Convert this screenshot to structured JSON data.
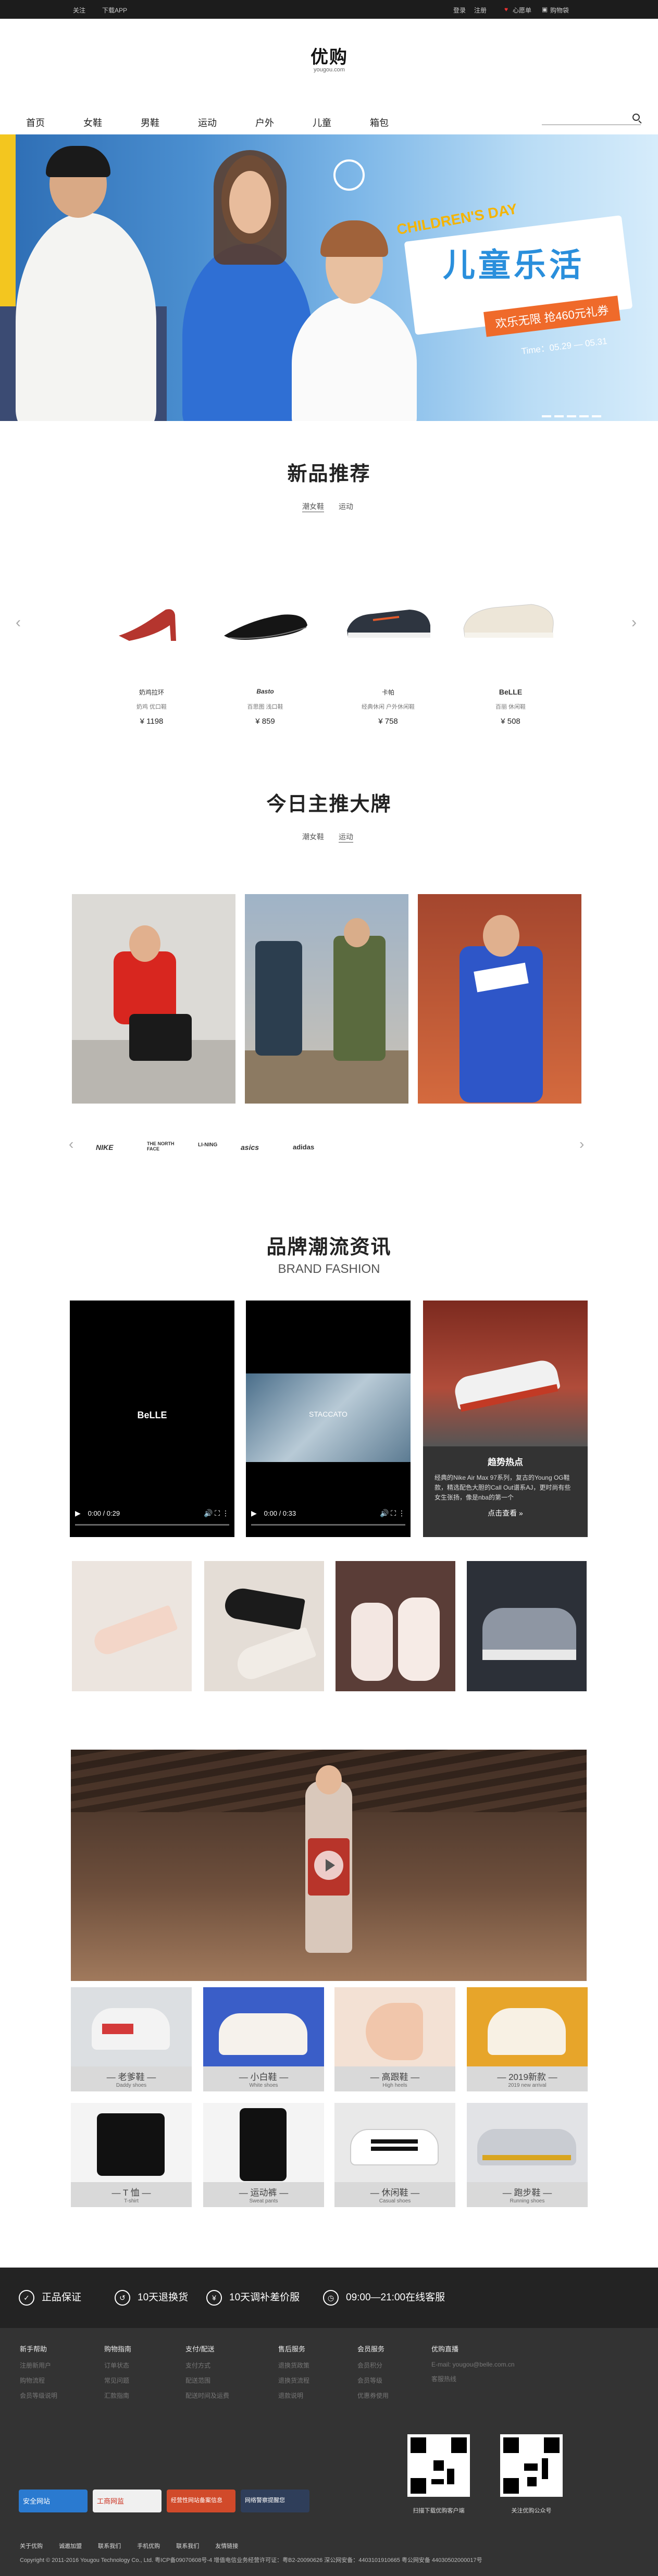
{
  "topbar": {
    "left": [
      "关注",
      "下载APP"
    ],
    "right": [
      "登录",
      "注册",
      "心愿单",
      "购物袋"
    ]
  },
  "logo": {
    "cn": "优购",
    "en": "yougou.com"
  },
  "nav": {
    "items": [
      "首页",
      "女鞋",
      "男鞋",
      "运动",
      "户外",
      "儿童",
      "箱包"
    ]
  },
  "banner": {
    "kids_day": "CHILDREN'S DAY",
    "title": "儿童乐活",
    "promo": "欢乐无限  抢460元礼券",
    "time": "Time：05.29 — 05.31"
  },
  "new_products": {
    "title": "新品推荐",
    "tabs": [
      "潮女鞋",
      "运动"
    ],
    "items": [
      {
        "brand": "奶鸡拉环",
        "name": "奶鸡 优口鞋",
        "price": "¥ 1198"
      },
      {
        "brand": "Basto",
        "name": "百思图 浅口鞋",
        "price": "¥ 859"
      },
      {
        "brand": "卡帕",
        "name": "经典休闲 户外休闲鞋",
        "price": "¥ 758"
      },
      {
        "brand": "BeLLE",
        "name": "百丽 休闲鞋",
        "price": "¥ 508"
      }
    ]
  },
  "brands": {
    "title": "今日主推大牌",
    "tabs": [
      "潮女鞋",
      "运动"
    ],
    "logos": [
      "NIKE",
      "THE NORTH FACE",
      "LI-NING",
      "asics",
      "adidas"
    ]
  },
  "fashion": {
    "title": "品牌潮流资讯",
    "subtitle": "BRAND FASHION",
    "video1": {
      "logo": "BeLLE",
      "time": "0:00 / 0:29"
    },
    "video2": {
      "caption": "STACCATO",
      "time": "0:00 / 0:33"
    },
    "trend": {
      "heading": "趋势热点",
      "text": "经典的Nike Air Max 97系列，复古的Young OG鞋款，精选配色大胆的Call Out谱系AJ，更时尚有些女生张扬，像是nba的第一个",
      "link": "点击查看 »"
    }
  },
  "categories": [
    {
      "cn": "— 老爹鞋 —",
      "en": "Daddy shoes"
    },
    {
      "cn": "— 小白鞋 —",
      "en": "White shoes"
    },
    {
      "cn": "— 高跟鞋 —",
      "en": "High heels"
    },
    {
      "cn": "— 2019新款 —",
      "en": "2019 new arrival"
    },
    {
      "cn": "— T 恤 —",
      "en": "T-shirt"
    },
    {
      "cn": "— 运动裤 —",
      "en": "Sweat pants"
    },
    {
      "cn": "— 休闲鞋 —",
      "en": "Casual shoes"
    },
    {
      "cn": "— 跑步鞋 —",
      "en": "Running shoes"
    }
  ],
  "service": [
    "正品保证",
    "10天退换货",
    "10天调补差价服",
    "09:00—21:00在线客服"
  ],
  "footer": {
    "columns": [
      {
        "h": "新手帮助",
        "items": [
          "注册新用户",
          "购物流程",
          "会员等级说明"
        ]
      },
      {
        "h": "购物指南",
        "items": [
          "订单状态",
          "常见问题",
          "汇款指南"
        ]
      },
      {
        "h": "支付/配送",
        "items": [
          "支付方式",
          "配送范围",
          "配送时间及运费"
        ]
      },
      {
        "h": "售后服务",
        "items": [
          "退换货政策",
          "退换货流程",
          "退款说明"
        ]
      },
      {
        "h": "会员服务",
        "items": [
          "会员积分",
          "会员等级",
          "优惠券使用"
        ]
      },
      {
        "h": "优购直播",
        "items": [
          "E-mail: yougou@belle.com.cn",
          "客服热线"
        ]
      }
    ],
    "qr_labels": [
      "扫描下载优购客户端",
      "关注优购公众号"
    ],
    "certs": [
      "安全网站",
      "工商网监",
      "经营性网站备案信息",
      "网络警察提醒您"
    ],
    "links": [
      "关于优购",
      "诚邀加盟",
      "联系我们",
      "手机优购",
      "联系我们",
      "友情链接"
    ],
    "copyright": "Copyright © 2011-2016 Yougou Technology Co., Ltd. 粤ICP备09070608号-4 增值电信业务经营许可证：粤B2-20090626  深公网安备：4403101910665  粤公网安备 44030502000017号"
  }
}
